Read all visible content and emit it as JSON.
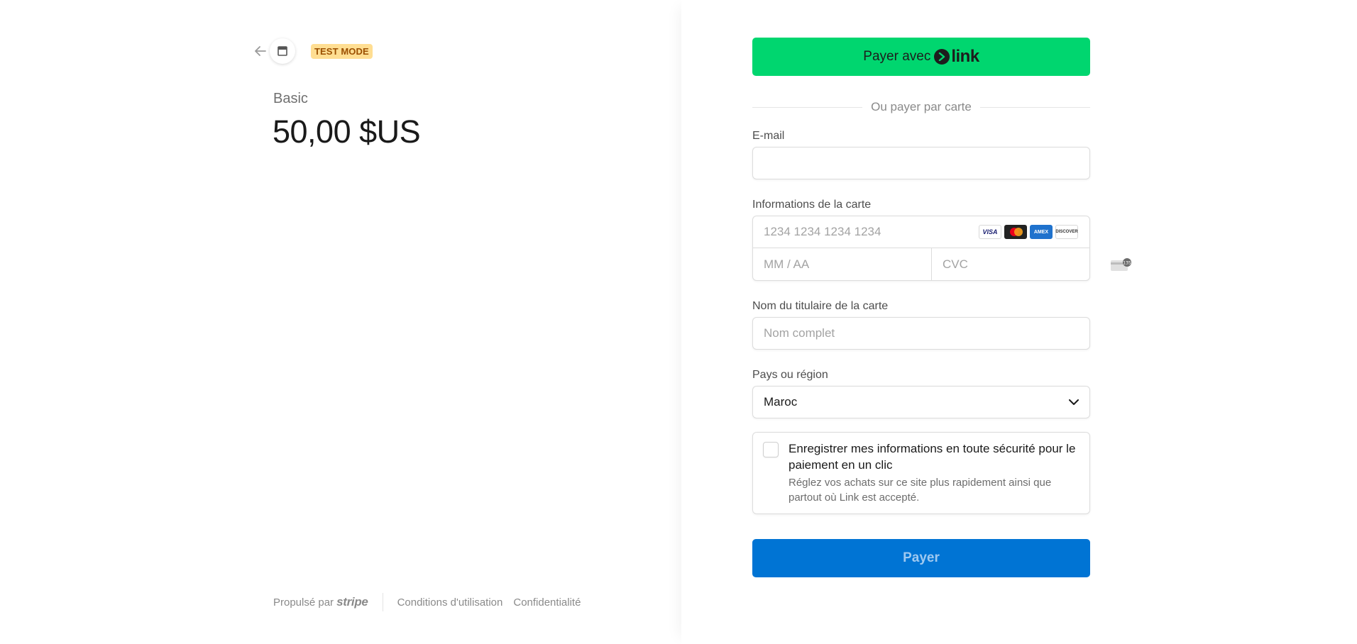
{
  "header": {
    "badge": "TEST MODE"
  },
  "product": {
    "name": "Basic",
    "price": "50,00 $US"
  },
  "footer": {
    "powered_by": "Propulsé par",
    "brand": "stripe",
    "terms": "Conditions d'utilisation",
    "privacy": "Confidentialité"
  },
  "link_button": {
    "label": "Payer avec",
    "logo_text": "link"
  },
  "divider_text": "Ou payer par carte",
  "email": {
    "label": "E-mail",
    "value": "",
    "placeholder": ""
  },
  "card": {
    "label": "Informations de la carte",
    "number_placeholder": "1234 1234 1234 1234",
    "expiry_placeholder": "MM / AA",
    "cvc_placeholder": "CVC",
    "brands": [
      "VISA",
      "mastercard-icon",
      "AMEX",
      "DISCOVER"
    ],
    "cvc_digits": "135"
  },
  "cardholder": {
    "label": "Nom du titulaire de la carte",
    "placeholder": "Nom complet"
  },
  "country": {
    "label": "Pays ou région",
    "selected": "Maroc"
  },
  "save_info": {
    "title": "Enregistrer mes informations en toute sécurité pour le paiement en un clic",
    "description": "Réglez vos achats sur ce site plus rapidement ainsi que partout où Link est accepté."
  },
  "pay_button": {
    "label": "Payer"
  },
  "colors": {
    "link_green": "#00d66f",
    "pay_blue": "#0074d4",
    "badge_bg": "#ffde92",
    "badge_text": "#9b4f00"
  }
}
